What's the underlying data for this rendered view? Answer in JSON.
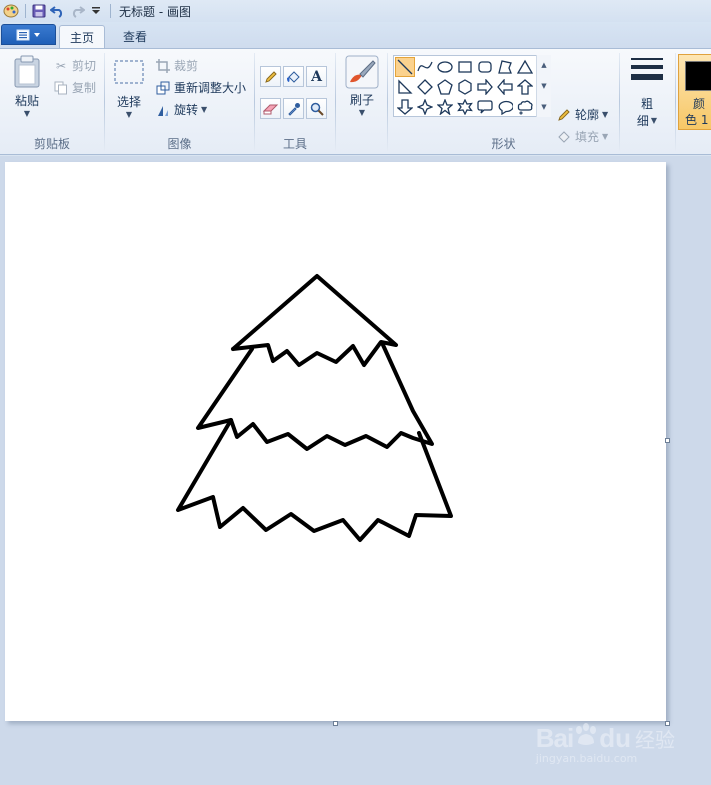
{
  "titlebar": {
    "title": "无标题 - 画图"
  },
  "tabs": {
    "home": "主页",
    "view": "查看"
  },
  "clipboard": {
    "paste": "粘贴",
    "cut": "剪切",
    "copy": "复制",
    "group": "剪贴板"
  },
  "image": {
    "select": "选择",
    "crop": "裁剪",
    "resize": "重新调整大小",
    "rotate": "旋转",
    "group": "图像"
  },
  "tools": {
    "group": "工具"
  },
  "brushes": {
    "label": "刷子"
  },
  "shapes": {
    "outline": "轮廓",
    "fill": "填充",
    "group": "形状"
  },
  "size": {
    "label_top": "粗",
    "label_bottom": "细"
  },
  "colors": {
    "label_top": "颜",
    "label_bottom": "色 1",
    "color1": "#000000"
  },
  "watermark": {
    "bai": "Bai",
    "du": "du",
    "jingyan": "经验",
    "url": "jingyan.baidu.com"
  }
}
